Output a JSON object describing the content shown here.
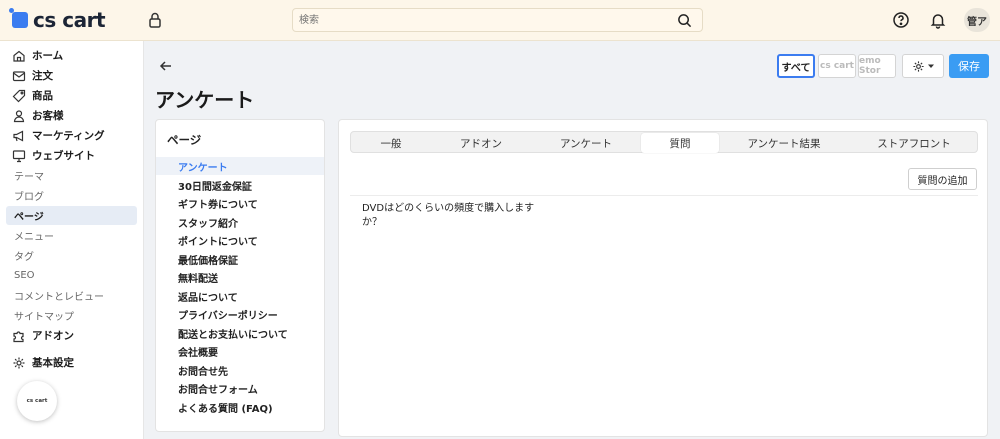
{
  "app": {
    "logo_text": "cs cart"
  },
  "search": {
    "placeholder": "検索"
  },
  "user": {
    "avatar_text": "管ア"
  },
  "sidebar": {
    "items": [
      {
        "label": "ホーム",
        "icon": "home-icon"
      },
      {
        "label": "注文",
        "icon": "inbox-icon"
      },
      {
        "label": "商品",
        "icon": "tag-icon"
      },
      {
        "label": "お客様",
        "icon": "user-icon"
      },
      {
        "label": "マーケティング",
        "icon": "megaphone-icon"
      },
      {
        "label": "ウェブサイト",
        "icon": "monitor-icon"
      },
      {
        "label": "テーマ"
      },
      {
        "label": "ブログ"
      },
      {
        "label": "ページ"
      },
      {
        "label": "メニュー"
      },
      {
        "label": "タグ"
      },
      {
        "label": "SEO"
      },
      {
        "label": "コメントとレビュー"
      },
      {
        "label": "サイトマップ"
      },
      {
        "label": "アドオン",
        "icon": "puzzle-icon"
      },
      {
        "label": "基本設定",
        "icon": "gear-icon"
      }
    ],
    "store_badge": "cs cart"
  },
  "header": {
    "title": "アンケート",
    "storefront_all": "すべて",
    "storefront_1": "cs cart",
    "storefront_2": "emo Stor",
    "save_label": "保存"
  },
  "pages_panel": {
    "heading": "ページ",
    "items": [
      "アンケート",
      "30日間返金保証",
      "ギフト券について",
      "スタッフ紹介",
      "ポイントについて",
      "最低価格保証",
      "無料配送",
      "返品について",
      "プライバシーポリシー",
      "配送とお支払いについて",
      "会社概要",
      "お問合せ先",
      "お問合せフォーム",
      "よくある質問 (FAQ)"
    ],
    "active_index": 0
  },
  "main": {
    "tabs": [
      "一般",
      "アドオン",
      "アンケート",
      "質問",
      "アンケート結果",
      "ストアフロント"
    ],
    "active_tab": 3,
    "add_question_label": "質問の追加",
    "question_text": "DVDはどのくらいの頻度で購入しますか？"
  },
  "colors": {
    "accent": "#3b7cf0",
    "save": "#3a9cf3",
    "topbar": "#fdf6e9"
  }
}
